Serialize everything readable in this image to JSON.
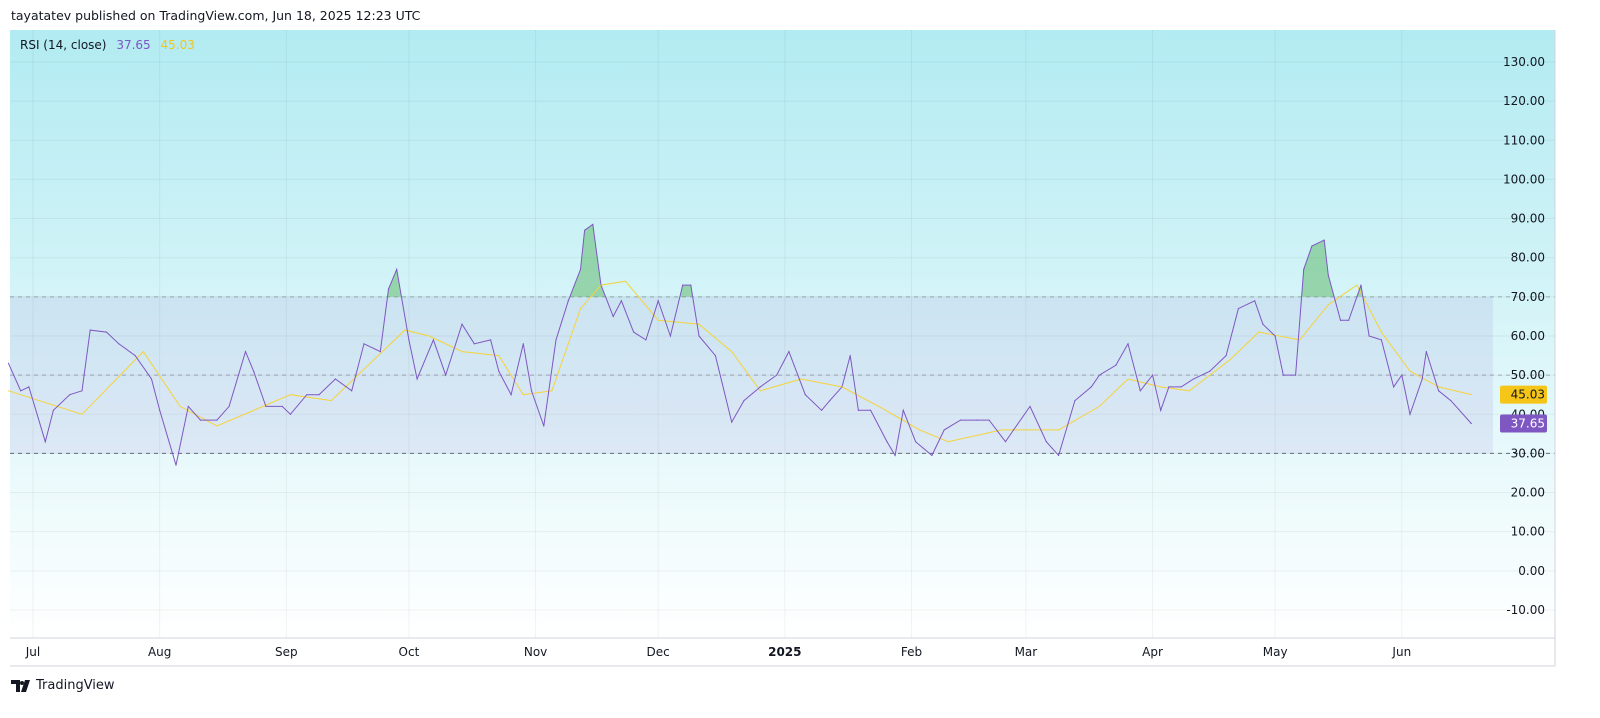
{
  "header": {
    "text": "tayatatev published on TradingView.com, Jun 18, 2025 12:23 UTC"
  },
  "legend": {
    "name": "RSI (14, close)",
    "rsi_value": "37.65",
    "ma_value": "45.03"
  },
  "logo": {
    "text": "TradingView"
  },
  "colors": {
    "rsi": "#7e57c2",
    "ma": "#f5d33a",
    "band": "#7e57c2",
    "overbought_fill": "#4caf50"
  },
  "chart_data": {
    "type": "line",
    "title": "RSI (14, close)",
    "x_unit": "days since 2024-07-01",
    "xticks": [
      {
        "label": "Jul",
        "d": 0
      },
      {
        "label": "Aug",
        "d": 31
      },
      {
        "label": "Sep",
        "d": 62
      },
      {
        "label": "Oct",
        "d": 92
      },
      {
        "label": "Nov",
        "d": 123
      },
      {
        "label": "Dec",
        "d": 153
      },
      {
        "label": "2025",
        "d": 184,
        "bold": true
      },
      {
        "label": "Feb",
        "d": 215
      },
      {
        "label": "Mar",
        "d": 243
      },
      {
        "label": "Apr",
        "d": 274
      },
      {
        "label": "May",
        "d": 304
      },
      {
        "label": "Jun",
        "d": 335
      }
    ],
    "yticks": [
      "130.00",
      "120.00",
      "110.00",
      "100.00",
      "90.00",
      "80.00",
      "70.00",
      "60.00",
      "50.00",
      "40.00",
      "30.00",
      "20.00",
      "10.00",
      "0.00",
      "-10.00"
    ],
    "ylim": [
      -10,
      130
    ],
    "bands": {
      "upper": 70,
      "middle": 50,
      "lower": 30
    },
    "series": [
      {
        "name": "RSI",
        "last_label": "37.65",
        "x": [
          -6,
          -3,
          -1,
          3,
          5,
          9,
          12,
          14,
          18,
          21,
          25,
          29,
          31,
          35,
          38,
          41,
          45,
          48,
          52,
          54,
          57,
          61,
          63,
          67,
          70,
          74,
          78,
          81,
          85,
          87,
          89,
          92,
          94,
          98,
          101,
          105,
          108,
          112,
          114,
          117,
          120,
          122,
          125,
          128,
          131,
          134,
          135,
          137,
          139,
          142,
          144,
          147,
          150,
          153,
          156,
          159,
          161,
          163,
          167,
          171,
          174,
          178,
          182,
          185,
          189,
          193,
          195,
          198,
          200,
          202,
          205,
          209,
          211,
          213,
          216,
          220,
          223,
          227,
          231,
          234,
          238,
          240,
          244,
          248,
          251,
          255,
          259,
          261,
          265,
          268,
          271,
          274,
          276,
          278,
          281,
          284,
          288,
          292,
          295,
          299,
          301,
          304,
          306,
          309,
          311,
          313,
          316,
          317,
          320,
          322,
          325,
          327,
          330,
          333,
          335,
          337,
          340,
          341,
          344,
          347,
          352
        ],
        "values": [
          53,
          46,
          47,
          33,
          41,
          45,
          46,
          61.5,
          61,
          58,
          55,
          49,
          41,
          27,
          42,
          38.5,
          38.5,
          42,
          56,
          51,
          42,
          42,
          40,
          45,
          45,
          49,
          46,
          58,
          56,
          72,
          77,
          59,
          49,
          59,
          50,
          63,
          58,
          59,
          51,
          45,
          58,
          46,
          37,
          59,
          69,
          77,
          87,
          88.5,
          73,
          65,
          69,
          61,
          59,
          69,
          60,
          73,
          73,
          60,
          55,
          38,
          43.5,
          47,
          50,
          56,
          45,
          41,
          43.5,
          47,
          55,
          41,
          41,
          33,
          29.5,
          41,
          33,
          29.5,
          36,
          38.5,
          38.5,
          38.5,
          33,
          36,
          42,
          33,
          29.5,
          43.5,
          47,
          50,
          52.5,
          58,
          46,
          50,
          41,
          47,
          47,
          49,
          51,
          55,
          67,
          69,
          63,
          60,
          50,
          50,
          77,
          83,
          84.5,
          75.5,
          64,
          64,
          73,
          60,
          59,
          47,
          50,
          40,
          49,
          56,
          46,
          43.5,
          37.65
        ]
      },
      {
        "name": "RSI-based MA",
        "last_label": "45.03",
        "x": [
          -6,
          12,
          27,
          36,
          45,
          63,
          73,
          82,
          91,
          97,
          105,
          114,
          120,
          127,
          134,
          139,
          145,
          153,
          163,
          171,
          178,
          188,
          198,
          207,
          217,
          224,
          237,
          244,
          251,
          261,
          268,
          276,
          283,
          293,
          300,
          310,
          317,
          324,
          330,
          337,
          344,
          352
        ],
        "values": [
          46,
          40,
          56,
          42,
          37,
          45,
          43.5,
          52.5,
          61.5,
          60,
          56,
          55,
          45,
          46,
          67,
          73,
          74,
          64,
          63,
          56,
          46,
          49,
          47,
          42,
          36,
          33,
          36,
          36,
          36,
          42,
          49,
          47,
          46,
          54,
          61,
          59,
          68,
          73,
          61,
          51,
          47,
          45.03
        ]
      }
    ]
  }
}
